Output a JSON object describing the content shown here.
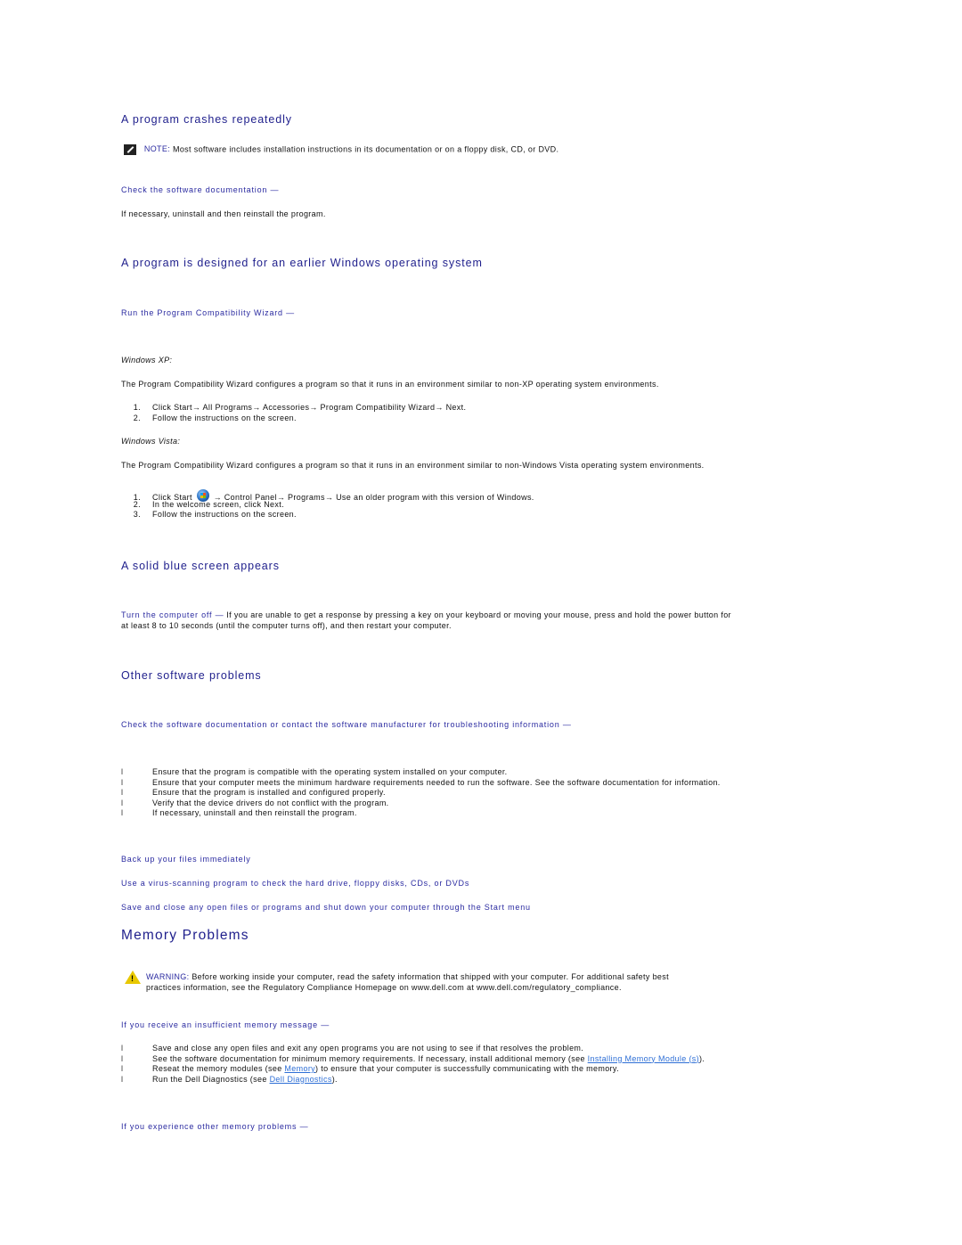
{
  "section_crashes": {
    "title": "A program crashes repeatedly",
    "note_label": "NOTE:",
    "note_text": " Most software includes installation instructions in its documentation or on a floppy disk, CD, or DVD.",
    "lead": "Check the software documentation —",
    "text": "If necessary, uninstall and then reinstall the program."
  },
  "section_earlier_windows": {
    "title": "A program is designed for an earlier Windows operating system",
    "lead": "Run the Program Compatibility Wizard —",
    "xp": {
      "label": "Windows XP:",
      "text": "The Program Compatibility Wizard configures a program so that it runs in an environment similar to non-XP operating system environments.",
      "steps": [
        "Click Start→ All Programs→ Accessories→ Program Compatibility Wizard→ Next.",
        "Follow the instructions on the screen."
      ]
    },
    "vista": {
      "label": "Windows Vista:",
      "text": "The Program Compatibility Wizard configures a program so that it runs in an environment similar to non-Windows Vista operating system environments.",
      "step1_prefix": "Click Start",
      "step1_suffix": "→ Control Panel→ Programs→ Use an older program with this version of Windows.",
      "steps_rest": [
        "In the welcome screen, click Next.",
        "Follow the instructions on the screen."
      ]
    }
  },
  "section_blue_screen": {
    "title": "A solid blue screen appears",
    "lead": "Turn the computer off —",
    "text_line1": " If you are unable to get a response by pressing a key on your keyboard or moving your mouse, press and hold the power button for",
    "text_line2": "at least 8 to 10 seconds (until the computer turns off), and then restart your computer."
  },
  "section_other": {
    "title": "Other software problems",
    "lead": "Check the software documentation or contact the software manufacturer for troubleshooting information —",
    "bullets": [
      "Ensure that the program is compatible with the operating system installed on your computer.",
      "Ensure that your computer meets the minimum hardware requirements needed to run the software. See the software documentation for information.",
      "Ensure that the program is installed and configured properly.",
      "Verify that the device drivers do not conflict with the program.",
      "If necessary, uninstall and then reinstall the program."
    ],
    "lead2": "Back up your files immediately",
    "lead3": "Use a virus-scanning program to check the hard drive, floppy disks, CDs, or DVDs",
    "lead4": "Save and close any open files or programs and shut down your computer through the Start menu"
  },
  "memory": {
    "title": "Memory Problems",
    "warning_label": "WARNING:",
    "warning_line1": " Before working inside your computer, read the safety information that shipped with your computer. For additional safety best",
    "warning_line2": "practices information, see the Regulatory Compliance Homepage on www.dell.com at www.dell.com/regulatory_compliance.",
    "lead": "If you receive an insufficient memory message —",
    "b1": "Save and close any open files and exit any open programs you are not using to see if that resolves the problem.",
    "b2_prefix": "See the software documentation for minimum memory requirements. If necessary, install additional memory (see ",
    "b2_link": "Installing Memory Module (s)",
    "b2_suffix": ").",
    "b3_prefix": "Reseat the memory modules (see ",
    "b3_link": "Memory",
    "b3_suffix": ") to ensure that your computer is successfully communicating with the memory.",
    "b4_prefix": "Run the Dell Diagnostics (see ",
    "b4_link": "Dell Diagnostics",
    "b4_suffix": ").",
    "lead2": "If you experience other memory problems —"
  },
  "icons": {
    "note": "note-pencil-icon",
    "warning": "warning-triangle-icon",
    "start": "windows-vista-start-orb-icon",
    "bullet": "l"
  }
}
